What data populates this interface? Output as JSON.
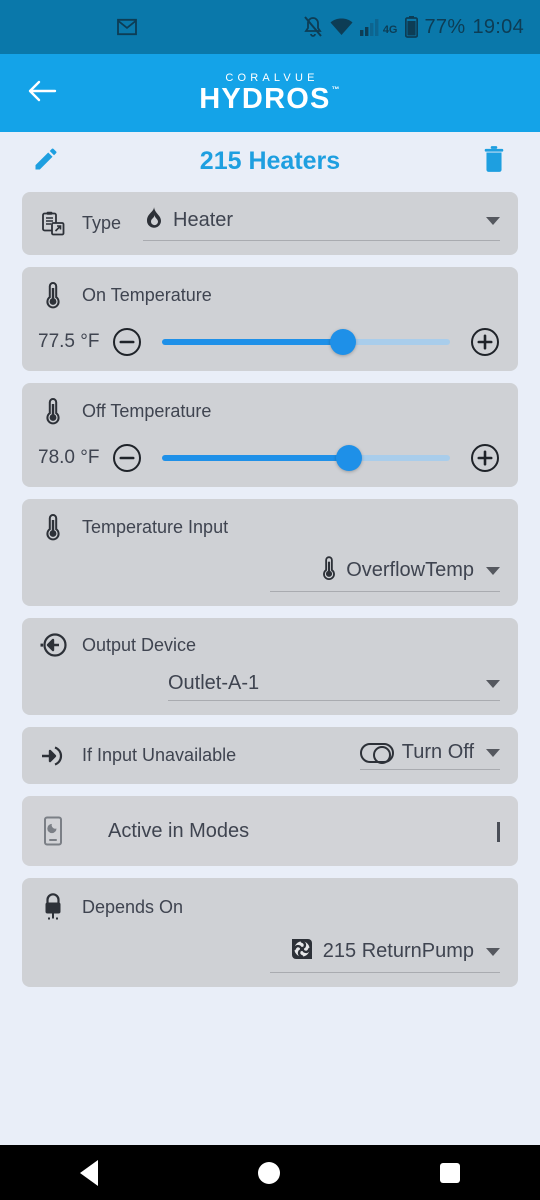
{
  "status_bar": {
    "notification_icon": "gmail-icon",
    "icons": [
      "notifications-off-icon",
      "wifi-icon",
      "cellular-signal-icon"
    ],
    "network_label": "4G",
    "battery_percent": "77%",
    "time": "19:04"
  },
  "app_bar": {
    "back_icon": "arrow-left-icon",
    "brand_sup": "CORALVUE",
    "brand_main": "HYDROS",
    "brand_tm": "™",
    "background_color": "#14a3e8"
  },
  "title_row": {
    "edit_icon": "pencil-icon",
    "title": "215 Heaters",
    "delete_icon": "trash-icon",
    "title_color": "#1e9fe0"
  },
  "sections": {
    "type": {
      "icon": "clipboard-export-icon",
      "label": "Type",
      "value_icon": "flame-icon",
      "value": "Heater"
    },
    "on_temperature": {
      "icon": "thermometer-icon",
      "label": "On Temperature",
      "value": "77.5 °F",
      "decrement_icon": "minus-circle-icon",
      "increment_icon": "plus-circle-icon",
      "slider_percent": 63
    },
    "off_temperature": {
      "icon": "thermometer-icon",
      "label": "Off Temperature",
      "value": "78.0 °F",
      "decrement_icon": "minus-circle-icon",
      "increment_icon": "plus-circle-icon",
      "slider_percent": 65
    },
    "temperature_input": {
      "icon": "thermometer-icon",
      "label": "Temperature Input",
      "value_icon": "thermometer-icon",
      "value": "OverflowTemp"
    },
    "output_device": {
      "icon": "output-arrow-icon",
      "label": "Output Device",
      "value": "Outlet-A-1"
    },
    "if_input_unavailable": {
      "icon": "input-arrow-icon",
      "label": "If Input Unavailable",
      "value_icon": "toggle-icon",
      "value": "Turn Off"
    },
    "active_in_modes": {
      "icon": "device-mode-icon",
      "label": "Active in Modes",
      "expand_icon": "chevron-down-icon"
    },
    "depends_on": {
      "icon": "lock-icon",
      "label": "Depends On",
      "value_icon": "pump-fan-icon",
      "value": "215 ReturnPump"
    }
  },
  "nav_bar": {
    "back": "back-triangle-icon",
    "home": "home-circle-icon",
    "recents": "recents-square-icon"
  }
}
